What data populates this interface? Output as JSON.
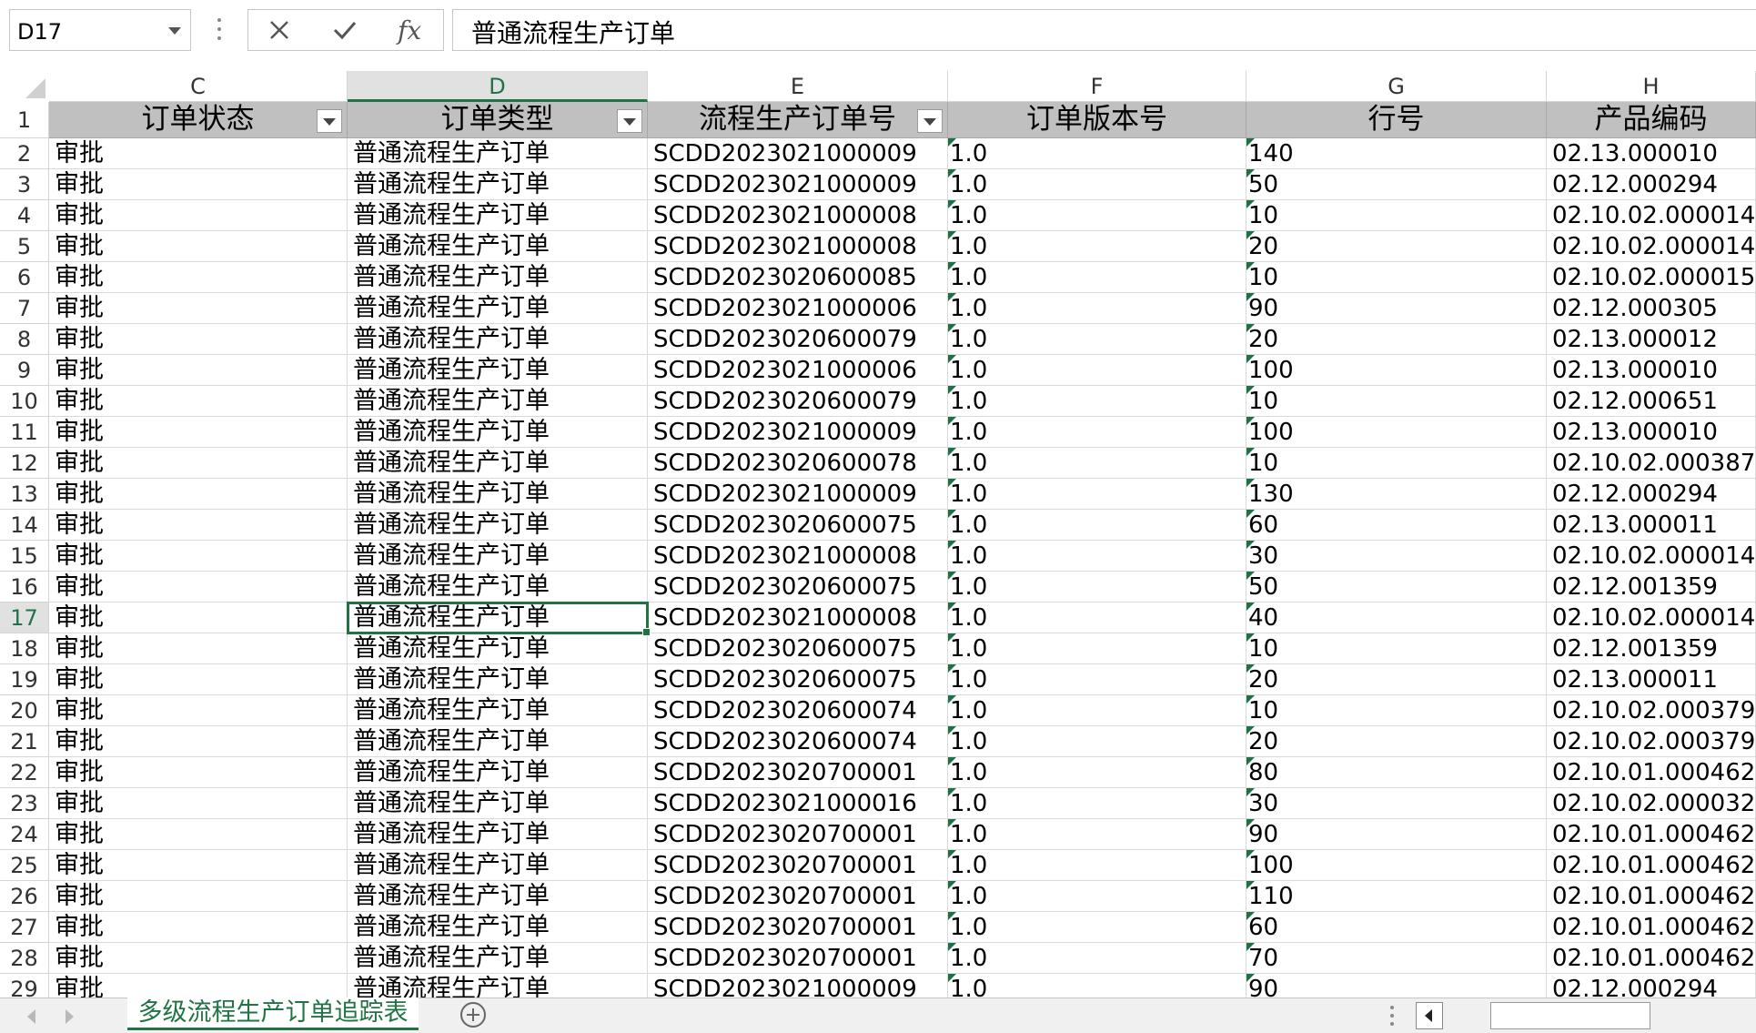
{
  "formula_bar": {
    "name_box": "D17",
    "fx_label": "fx",
    "formula_value": "普通流程生产订单"
  },
  "columns": [
    "C",
    "D",
    "E",
    "F",
    "G",
    "H"
  ],
  "selected_column": "D",
  "selected_row": "17",
  "header_row": {
    "row_number": "1",
    "cells": [
      "订单状态",
      "订单类型",
      "流程生产订单号",
      "订单版本号",
      "行号",
      "产品编码"
    ]
  },
  "rows": [
    {
      "n": "2",
      "status": "审批",
      "type": "普通流程生产订单",
      "order_no": "SCDD2023021000009",
      "version": "1.0",
      "line": "140",
      "product": "02.13.000010"
    },
    {
      "n": "3",
      "status": "审批",
      "type": "普通流程生产订单",
      "order_no": "SCDD2023021000009",
      "version": "1.0",
      "line": "50",
      "product": "02.12.000294"
    },
    {
      "n": "4",
      "status": "审批",
      "type": "普通流程生产订单",
      "order_no": "SCDD2023021000008",
      "version": "1.0",
      "line": "10",
      "product": "02.10.02.000014"
    },
    {
      "n": "5",
      "status": "审批",
      "type": "普通流程生产订单",
      "order_no": "SCDD2023021000008",
      "version": "1.0",
      "line": "20",
      "product": "02.10.02.000014"
    },
    {
      "n": "6",
      "status": "审批",
      "type": "普通流程生产订单",
      "order_no": "SCDD2023020600085",
      "version": "1.0",
      "line": "10",
      "product": "02.10.02.000015"
    },
    {
      "n": "7",
      "status": "审批",
      "type": "普通流程生产订单",
      "order_no": "SCDD2023021000006",
      "version": "1.0",
      "line": "90",
      "product": "02.12.000305"
    },
    {
      "n": "8",
      "status": "审批",
      "type": "普通流程生产订单",
      "order_no": "SCDD2023020600079",
      "version": "1.0",
      "line": "20",
      "product": "02.13.000012"
    },
    {
      "n": "9",
      "status": "审批",
      "type": "普通流程生产订单",
      "order_no": "SCDD2023021000006",
      "version": "1.0",
      "line": "100",
      "product": "02.13.000010"
    },
    {
      "n": "10",
      "status": "审批",
      "type": "普通流程生产订单",
      "order_no": "SCDD2023020600079",
      "version": "1.0",
      "line": "10",
      "product": "02.12.000651"
    },
    {
      "n": "11",
      "status": "审批",
      "type": "普通流程生产订单",
      "order_no": "SCDD2023021000009",
      "version": "1.0",
      "line": "100",
      "product": "02.13.000010"
    },
    {
      "n": "12",
      "status": "审批",
      "type": "普通流程生产订单",
      "order_no": "SCDD2023020600078",
      "version": "1.0",
      "line": "10",
      "product": "02.10.02.000387"
    },
    {
      "n": "13",
      "status": "审批",
      "type": "普通流程生产订单",
      "order_no": "SCDD2023021000009",
      "version": "1.0",
      "line": "130",
      "product": "02.12.000294"
    },
    {
      "n": "14",
      "status": "审批",
      "type": "普通流程生产订单",
      "order_no": "SCDD2023020600075",
      "version": "1.0",
      "line": "60",
      "product": "02.13.000011"
    },
    {
      "n": "15",
      "status": "审批",
      "type": "普通流程生产订单",
      "order_no": "SCDD2023021000008",
      "version": "1.0",
      "line": "30",
      "product": "02.10.02.000014"
    },
    {
      "n": "16",
      "status": "审批",
      "type": "普通流程生产订单",
      "order_no": "SCDD2023020600075",
      "version": "1.0",
      "line": "50",
      "product": "02.12.001359"
    },
    {
      "n": "17",
      "status": "审批",
      "type": "普通流程生产订单",
      "order_no": "SCDD2023021000008",
      "version": "1.0",
      "line": "40",
      "product": "02.10.02.000014"
    },
    {
      "n": "18",
      "status": "审批",
      "type": "普通流程生产订单",
      "order_no": "SCDD2023020600075",
      "version": "1.0",
      "line": "10",
      "product": "02.12.001359"
    },
    {
      "n": "19",
      "status": "审批",
      "type": "普通流程生产订单",
      "order_no": "SCDD2023020600075",
      "version": "1.0",
      "line": "20",
      "product": "02.13.000011"
    },
    {
      "n": "20",
      "status": "审批",
      "type": "普通流程生产订单",
      "order_no": "SCDD2023020600074",
      "version": "1.0",
      "line": "10",
      "product": "02.10.02.000379"
    },
    {
      "n": "21",
      "status": "审批",
      "type": "普通流程生产订单",
      "order_no": "SCDD2023020600074",
      "version": "1.0",
      "line": "20",
      "product": "02.10.02.000379"
    },
    {
      "n": "22",
      "status": "审批",
      "type": "普通流程生产订单",
      "order_no": "SCDD2023020700001",
      "version": "1.0",
      "line": "80",
      "product": "02.10.01.000462"
    },
    {
      "n": "23",
      "status": "审批",
      "type": "普通流程生产订单",
      "order_no": "SCDD2023021000016",
      "version": "1.0",
      "line": "30",
      "product": "02.10.02.000032"
    },
    {
      "n": "24",
      "status": "审批",
      "type": "普通流程生产订单",
      "order_no": "SCDD2023020700001",
      "version": "1.0",
      "line": "90",
      "product": "02.10.01.000462"
    },
    {
      "n": "25",
      "status": "审批",
      "type": "普通流程生产订单",
      "order_no": "SCDD2023020700001",
      "version": "1.0",
      "line": "100",
      "product": "02.10.01.000462"
    },
    {
      "n": "26",
      "status": "审批",
      "type": "普通流程生产订单",
      "order_no": "SCDD2023020700001",
      "version": "1.0",
      "line": "110",
      "product": "02.10.01.000462"
    },
    {
      "n": "27",
      "status": "审批",
      "type": "普通流程生产订单",
      "order_no": "SCDD2023020700001",
      "version": "1.0",
      "line": "60",
      "product": "02.10.01.000462"
    },
    {
      "n": "28",
      "status": "审批",
      "type": "普通流程生产订单",
      "order_no": "SCDD2023020700001",
      "version": "1.0",
      "line": "70",
      "product": "02.10.01.000462"
    },
    {
      "n": "29",
      "status": "审批",
      "type": "普通流程生产订单",
      "order_no": "SCDD2023021000009",
      "version": "1.0",
      "line": "90",
      "product": "02.12.000294"
    }
  ],
  "sheet_tabs": [
    "多级流程生产订单追踪表"
  ],
  "colors": {
    "accent": "#217346",
    "header_fill": "#c0c0c0",
    "error_triangle": "#1e7145"
  },
  "icons": {
    "cancel": "close-icon",
    "enter": "checkmark-icon",
    "function": "fx-icon",
    "add_sheet": "plus-circle-icon",
    "name_box_dropdown": "chevron-down-icon"
  }
}
